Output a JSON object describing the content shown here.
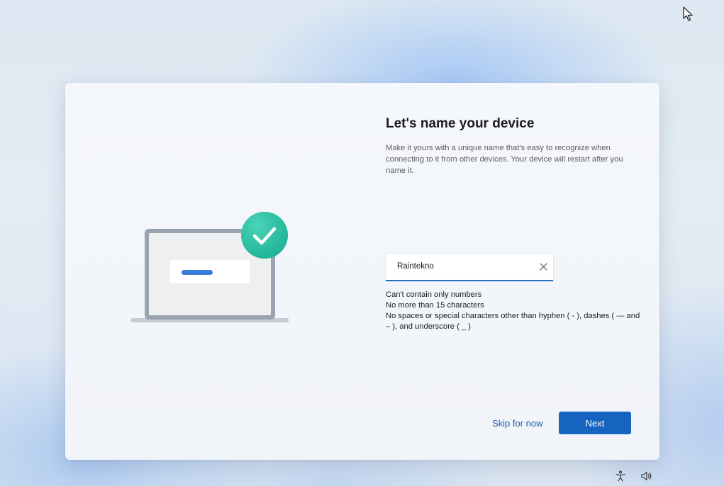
{
  "page": {
    "title": "Let's name your device",
    "description": "Make it yours with a unique name that's easy to recognize when connecting to it from other devices. Your device will restart after you name it."
  },
  "device_name_input": {
    "value": "Raintekno",
    "placeholder": ""
  },
  "rules": [
    "Can't contain only numbers",
    "No more than 15 characters",
    "No spaces or special characters other than hyphen ( - ), dashes ( — and – ), and underscore ( _ )"
  ],
  "actions": {
    "skip_label": "Skip for now",
    "next_label": "Next"
  },
  "icons": {
    "illustration": "laptop-with-checkmark-illustration",
    "clear": "close-icon",
    "cursor": "mouse-pointer-icon",
    "accessibility": "accessibility-icon",
    "volume": "volume-icon"
  },
  "colors": {
    "accent": "#1565c0",
    "link": "#1a5fb4",
    "check_badge": "#2ec4a6"
  }
}
